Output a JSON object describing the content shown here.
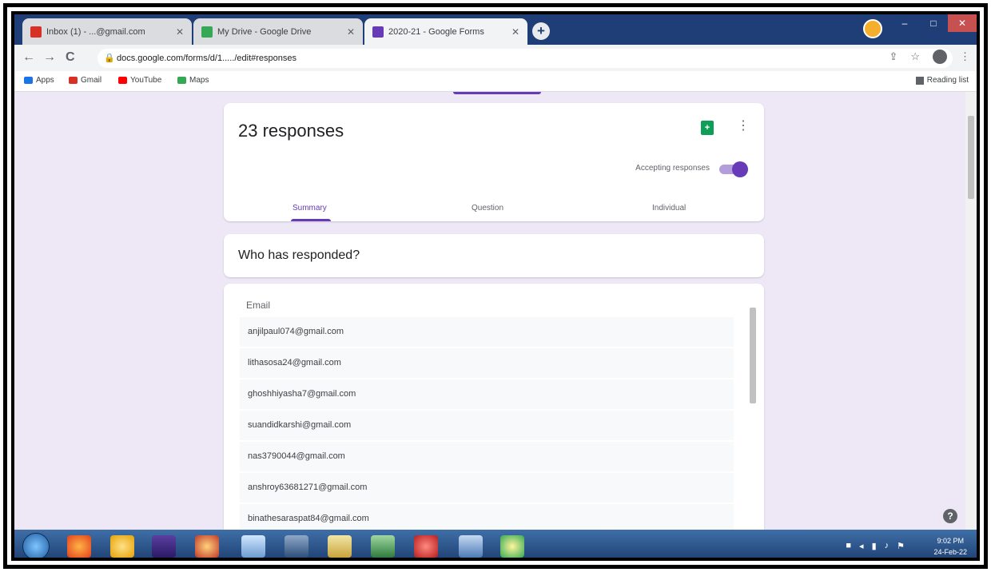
{
  "browser": {
    "tabs": [
      {
        "title": "Inbox (1) - ...@gmail.com",
        "favicon": "gmail-icon",
        "active": false
      },
      {
        "title": "My Drive - Google Drive",
        "favicon": "drive-icon",
        "active": false
      },
      {
        "title": "2020-21 - Google Forms",
        "favicon": "forms-icon",
        "active": true
      }
    ],
    "new_tab_label": "+",
    "url": "docs.google.com/forms/d/1...../edit#responses",
    "bookmarks": [
      {
        "label": "Apps",
        "icon": "apps-grid-icon"
      },
      {
        "label": "Gmail",
        "icon": "gmail-icon"
      },
      {
        "label": "YouTube",
        "icon": "youtube-icon"
      },
      {
        "label": "Maps",
        "icon": "maps-icon"
      }
    ],
    "reading_list": "Reading list"
  },
  "form": {
    "responses_title": "23 responses",
    "accepting_label": "Accepting responses",
    "tabs": [
      "Summary",
      "Question",
      "Individual"
    ],
    "active_tab": "Summary",
    "who_title": "Who has responded?",
    "email_header": "Email",
    "emails": [
      "anjilpaul074@gmail.com",
      "lithasosa24@gmail.com",
      "ghoshhiyasha7@gmail.com",
      "suandidkarshi@gmail.com",
      "nas3790044@gmail.com",
      "anshroy63681271@gmail.com",
      "binathesaraspat84@gmail.com"
    ]
  },
  "taskbar": {
    "time": "9:02 PM",
    "date": "24-Feb-22"
  },
  "colors": {
    "accent": "#673ab7",
    "page_bg": "#ede7f6",
    "sheets_green": "#0f9d58",
    "taskbar": "#1b3c6d"
  }
}
